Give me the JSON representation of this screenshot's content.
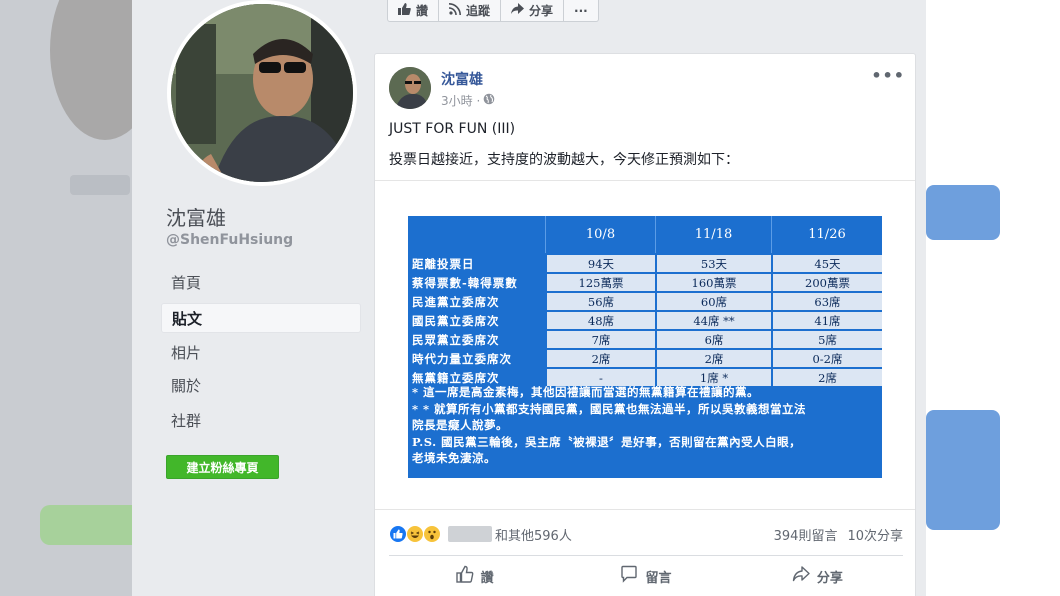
{
  "profile": {
    "name": "沈富雄",
    "handle": "@ShenFuHsiung",
    "nav": [
      {
        "label": "首頁"
      },
      {
        "label": "貼文"
      },
      {
        "label": "相片"
      },
      {
        "label": "關於"
      },
      {
        "label": "社群"
      }
    ],
    "create_button": "建立粉絲專頁"
  },
  "top_actions": {
    "like": "讚",
    "follow": "追蹤",
    "share": "分享",
    "more": "···"
  },
  "post": {
    "author": "沈富雄",
    "time": "3小時 ·",
    "more": "•••",
    "line1": "JUST FOR FUN (III)",
    "line2": "投票日越接近，支持度的波動越大，今天修正預測如下：",
    "table": {
      "headers": [
        "",
        "10/8",
        "11/18",
        "11/26"
      ],
      "rows": [
        {
          "label": "距離投票日",
          "v": [
            "94天",
            "53天",
            "45天"
          ]
        },
        {
          "label": "蔡得票數-韓得票數",
          "v": [
            "125萬票",
            "160萬票",
            "200萬票"
          ]
        },
        {
          "label": "民進黨立委席次",
          "v": [
            "56席",
            "60席",
            "63席"
          ]
        },
        {
          "label": "國民黨立委席次",
          "v": [
            "48席",
            "44席 **",
            "41席"
          ]
        },
        {
          "label": "民眾黨立委席次",
          "v": [
            "7席",
            "6席",
            "5席"
          ]
        },
        {
          "label": "時代力量立委席次",
          "v": [
            "2席",
            "2席",
            "0-2席"
          ]
        },
        {
          "label": "無黨籍立委席次",
          "v": [
            "-",
            "1席 *",
            "2席"
          ]
        }
      ],
      "notes": [
        "* 這一席是高金素梅，其他因禮讓而當選的無黨籍算在禮讓的黨。",
        "* * 就算所有小黨都支持國民黨，國民黨也無法過半，所以吳敦義想當立法",
        "   院長是癡人說夢。",
        "P.S. 國民黨三輪後，吳主席〝被裸退〞是好事，否則留在黨內受人白眼，",
        "   老境未免淒涼。"
      ]
    },
    "reactions_text": "和其他596人",
    "comments": "394則留言",
    "shares": "10次分享",
    "actions": {
      "like": "讚",
      "comment": "留言",
      "share": "分享"
    }
  },
  "colors": {
    "link_blue": "#365899",
    "table_blue": "#1c6fcf",
    "create_green": "#42b72a",
    "page_gray": "#e9ebee"
  }
}
